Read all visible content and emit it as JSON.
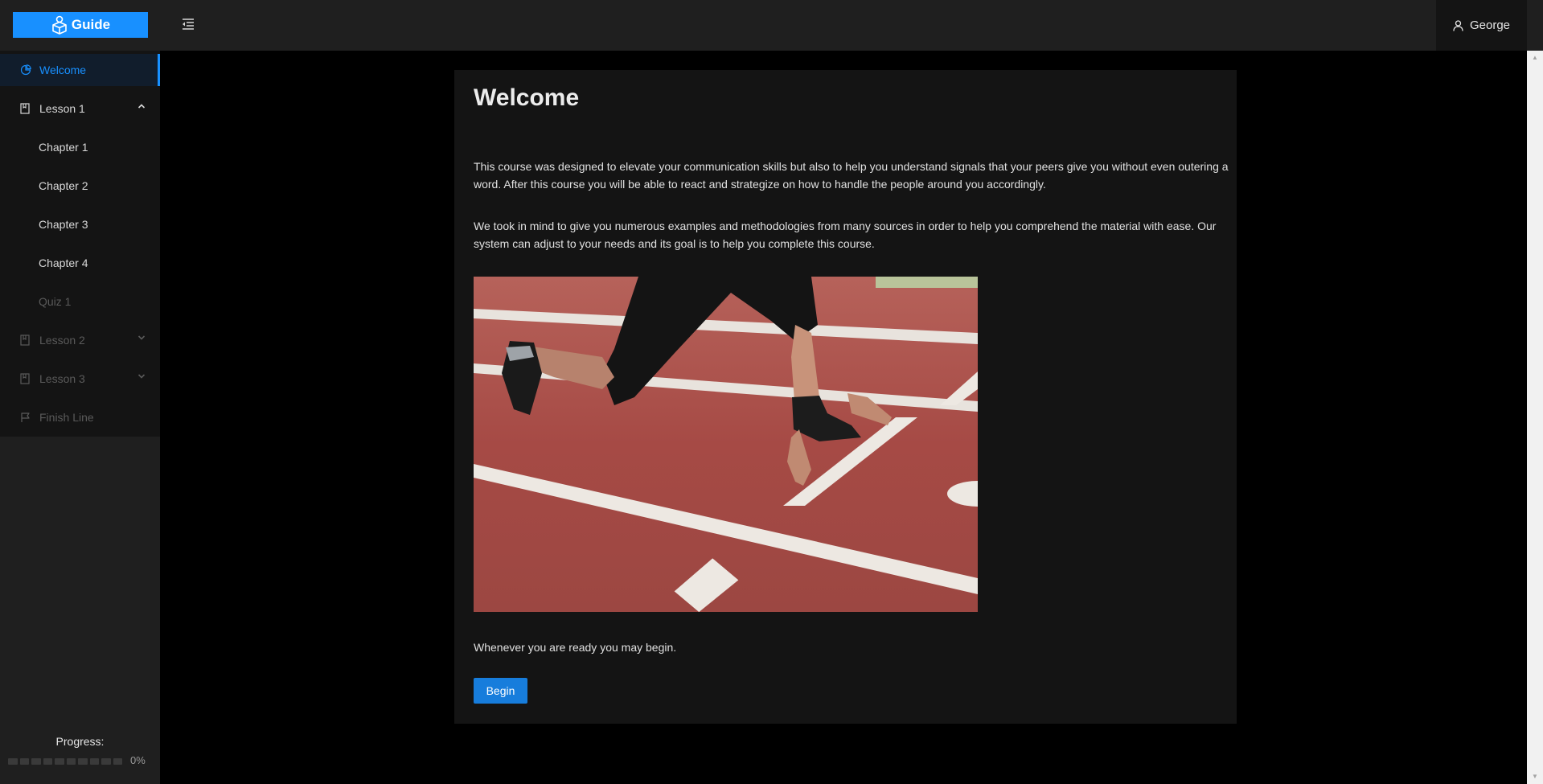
{
  "header": {
    "logo_text": "Guide",
    "logo_icon": "cube-person-icon",
    "menu_toggle_icon": "menu-fold-icon",
    "user_name": "George",
    "user_icon": "user-icon"
  },
  "sidebar": {
    "items": [
      {
        "label": "Welcome",
        "icon": "pie-icon",
        "state": "active"
      },
      {
        "label": "Lesson 1",
        "icon": "book-icon",
        "state": "enabled",
        "expanded": true
      },
      {
        "label": "Chapter 1",
        "state": "enabled"
      },
      {
        "label": "Chapter 2",
        "state": "enabled"
      },
      {
        "label": "Chapter 3",
        "state": "enabled"
      },
      {
        "label": "Chapter 4",
        "state": "enabled"
      },
      {
        "label": "Quiz 1",
        "state": "disabled"
      },
      {
        "label": "Lesson 2",
        "icon": "book-icon",
        "state": "disabled",
        "expanded": false
      },
      {
        "label": "Lesson 3",
        "icon": "book-icon",
        "state": "disabled",
        "expanded": false
      },
      {
        "label": "Finish Line",
        "icon": "flag-icon",
        "state": "disabled"
      }
    ],
    "progress_label": "Progress:",
    "progress_value": "0%",
    "progress_fraction": 0
  },
  "main": {
    "title": "Welcome",
    "paragraphs": [
      "This course was designed to elevate your communication skills but also to help you understand signals that your peers give you without even outering a word. After this course you will be able to react and strategize on how to handle the people around you accordingly.",
      "We took in mind to give you numerous examples and methodologies from many sources in order to help you comprehend the material with ease. Our system can adjust to your needs and its goal is to help you complete this course.",
      "Whenever you are ready you may begin."
    ],
    "image_subject": "runner-starting-position-photo",
    "begin_label": "Begin"
  },
  "colors": {
    "accent": "#1890ff",
    "button": "#177ddc",
    "header_bg": "#1f1f1f",
    "sidebar_menu_bg": "#141414",
    "card_bg": "#141414",
    "page_bg": "#000000",
    "track_red": "#a64a45"
  }
}
